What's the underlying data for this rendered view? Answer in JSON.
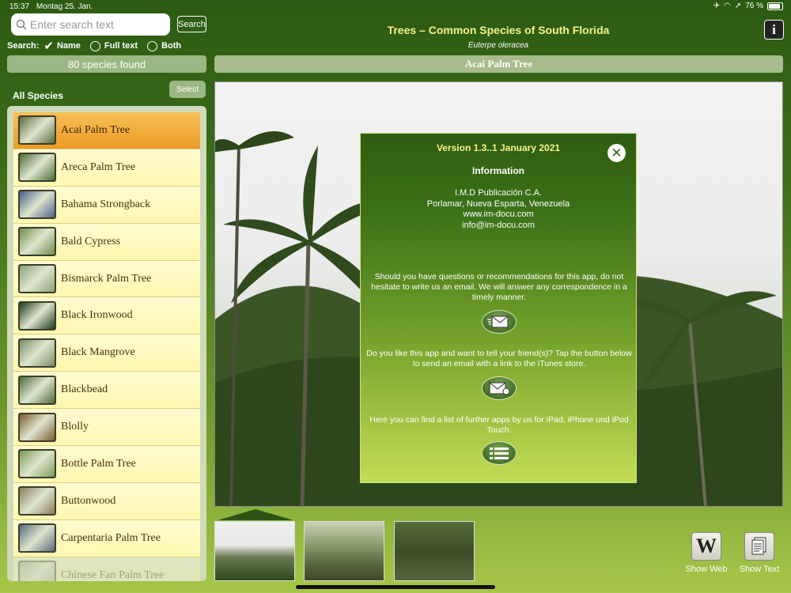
{
  "status_bar": {
    "time": "15:37",
    "date": "Montag 25. Jan.",
    "battery": "76 %"
  },
  "search": {
    "placeholder": "Enter search text",
    "button": "Search",
    "label": "Search:",
    "options": [
      "Name",
      "Full text",
      "Both"
    ],
    "selected": "Name"
  },
  "found": "80 species found",
  "list_header": {
    "title": "All Species",
    "select": "Select"
  },
  "species": [
    {
      "name": "Acai Palm Tree",
      "selected": true,
      "color": "#5a6b3c"
    },
    {
      "name": "Areca Palm Tree",
      "color": "#4d6b35"
    },
    {
      "name": "Bahama Strongback",
      "color": "#4a5e8a"
    },
    {
      "name": "Bald Cypress",
      "color": "#6e8c4a"
    },
    {
      "name": "Bismarck Palm Tree",
      "color": "#8fa07a"
    },
    {
      "name": "Black Ironwood",
      "color": "#1f3a1a"
    },
    {
      "name": "Black Mangrove",
      "color": "#7a8a66"
    },
    {
      "name": "Blackbead",
      "color": "#4e6a38"
    },
    {
      "name": "Blolly",
      "color": "#7c5a2c"
    },
    {
      "name": "Bottle Palm Tree",
      "color": "#7c9a58"
    },
    {
      "name": "Buttonwood",
      "color": "#8c7e5a"
    },
    {
      "name": "Carpentaria Palm Tree",
      "color": "#5a6a7a"
    },
    {
      "name": "Chinese Fan Palm Tree",
      "color": "#9aa882",
      "faded": true
    }
  ],
  "header": {
    "title": "Trees – Common Species of South Florida",
    "scientific_name": "Euterpe oleracea",
    "species_title": "Acai Palm Tree",
    "info": "i"
  },
  "popup": {
    "version": "Version 1.3..1 January 2021",
    "title": "Information",
    "address": [
      "I.M.D Publicación C.A.",
      "Porlamar, Nueva Esparta, Venezuela",
      "www.im-docu.com",
      "info@im-docu.com"
    ],
    "paragraph1": "Should you have questions or recommendations for this app, do not hesitate to write us an email. We will answer any correspondence in a timely manner.",
    "paragraph2": "Do you like this app and want to tell your friend(s)? Tap the button below to send an email with a link to the iTunes store.",
    "paragraph3": "Here you can find a list of further apps by us for iPad, iPhone und iPod Touch."
  },
  "tools": {
    "web": "Show Web",
    "text": "Show Text",
    "web_glyph": "W"
  }
}
